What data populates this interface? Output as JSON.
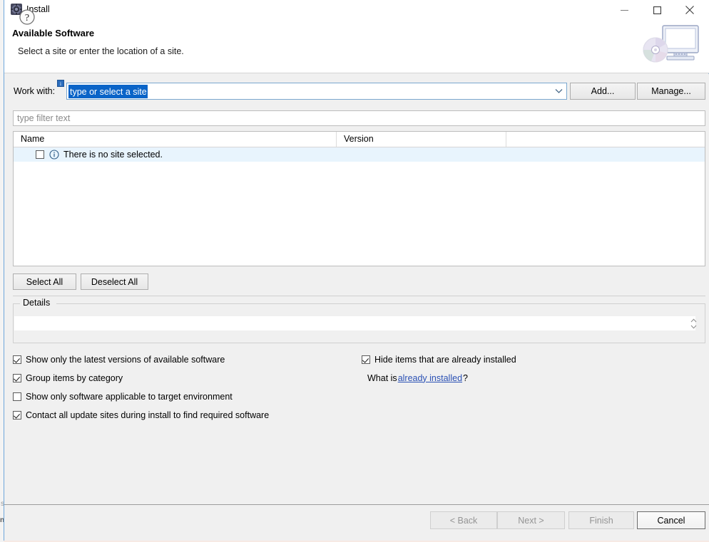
{
  "window": {
    "title": "Install",
    "icon": "eclipse-gear-icon",
    "controls": {
      "minimize": "minimize-icon",
      "maximize": "maximize-icon",
      "close": "close-icon"
    }
  },
  "header": {
    "title": "Available Software",
    "subtitle": "Select a site or enter the location of a site.",
    "banner_icon": "monitor-with-disc-icon"
  },
  "work_with": {
    "label": "Work with:",
    "info_badge": "i",
    "value": "type or select a site",
    "placeholder": "type or select a site",
    "dropdown_icon": "chevron-down-icon",
    "add_button": "Add...",
    "manage_button": "Manage..."
  },
  "filter": {
    "placeholder": "type filter text",
    "value": ""
  },
  "table": {
    "columns": [
      "Name",
      "Version",
      ""
    ],
    "rows": [
      {
        "checked": false,
        "icon": "info-circle-icon",
        "name": "There is no site selected.",
        "version": "",
        "selected": true
      }
    ]
  },
  "selection_buttons": {
    "select_all": "Select All",
    "deselect_all": "Deselect All"
  },
  "details": {
    "group_label": "Details",
    "text": "",
    "spinner_up_icon": "spinner-up-icon",
    "spinner_down_icon": "spinner-down-icon"
  },
  "options": {
    "left": [
      {
        "label": "Show only the latest versions of available software",
        "checked": true
      },
      {
        "label": "Group items by category",
        "checked": true
      },
      {
        "label": "Show only software applicable to target environment",
        "checked": false
      },
      {
        "label": "Contact all update sites during install to find required software",
        "checked": true
      }
    ],
    "right": [
      {
        "label": "Hide items that are already installed",
        "checked": true
      }
    ],
    "what_is_prefix": "What is ",
    "what_is_link": "already installed",
    "what_is_suffix": "?"
  },
  "footer": {
    "help_icon": "help-question-icon",
    "back": "< Back",
    "next": "Next >",
    "finish": "Finish",
    "cancel": "Cancel",
    "back_enabled": false,
    "next_enabled": false,
    "finish_enabled": false,
    "cancel_enabled": true
  },
  "background_ghost": {
    "line1": "s",
    "line2": "nt"
  },
  "colors": {
    "accent_selection": "#0a64c8",
    "link": "#2a50b4",
    "row_selected": "#e8f4fd",
    "dialog_bg": "#f0f0f0",
    "border": "#bdbdbd"
  }
}
